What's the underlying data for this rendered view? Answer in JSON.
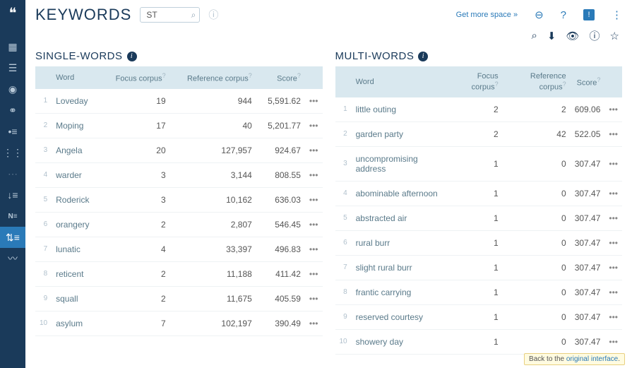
{
  "header": {
    "title": "KEYWORDS",
    "search_value": "ST",
    "get_more_space": "Get more space »"
  },
  "sidebar": {
    "items": [
      "grid",
      "list",
      "target",
      "rings",
      "indent",
      "levels",
      "dim",
      "downrank",
      "ne",
      "kw",
      "trend"
    ]
  },
  "panels": {
    "single": {
      "title": "SINGLE-WORDS",
      "cols": {
        "word": "Word",
        "focus": "Focus corpus",
        "ref": "Reference corpus",
        "score": "Score"
      }
    },
    "multi": {
      "title": "MULTI-WORDS",
      "cols": {
        "word": "Word",
        "focus": "Focus corpus",
        "ref": "Reference corpus",
        "score": "Score"
      }
    }
  },
  "chart_data": [
    {
      "type": "table",
      "title": "SINGLE-WORDS",
      "columns": [
        "Word",
        "Focus corpus",
        "Reference corpus",
        "Score"
      ],
      "rows": [
        {
          "idx": 1,
          "word": "Loveday",
          "focus": "19",
          "ref": "944",
          "score": "5,591.62"
        },
        {
          "idx": 2,
          "word": "Moping",
          "focus": "17",
          "ref": "40",
          "score": "5,201.77"
        },
        {
          "idx": 3,
          "word": "Angela",
          "focus": "20",
          "ref": "127,957",
          "score": "924.67"
        },
        {
          "idx": 4,
          "word": "warder",
          "focus": "3",
          "ref": "3,144",
          "score": "808.55"
        },
        {
          "idx": 5,
          "word": "Roderick",
          "focus": "3",
          "ref": "10,162",
          "score": "636.03"
        },
        {
          "idx": 6,
          "word": "orangery",
          "focus": "2",
          "ref": "2,807",
          "score": "546.45"
        },
        {
          "idx": 7,
          "word": "lunatic",
          "focus": "4",
          "ref": "33,397",
          "score": "496.83"
        },
        {
          "idx": 8,
          "word": "reticent",
          "focus": "2",
          "ref": "11,188",
          "score": "411.42"
        },
        {
          "idx": 9,
          "word": "squall",
          "focus": "2",
          "ref": "11,675",
          "score": "405.59"
        },
        {
          "idx": 10,
          "word": "asylum",
          "focus": "7",
          "ref": "102,197",
          "score": "390.49"
        }
      ]
    },
    {
      "type": "table",
      "title": "MULTI-WORDS",
      "columns": [
        "Word",
        "Focus corpus",
        "Reference corpus",
        "Score"
      ],
      "rows": [
        {
          "idx": 1,
          "word": "little outing",
          "focus": "2",
          "ref": "2",
          "score": "609.06"
        },
        {
          "idx": 2,
          "word": "garden party",
          "focus": "2",
          "ref": "42",
          "score": "522.05"
        },
        {
          "idx": 3,
          "word": "uncompromising address",
          "focus": "1",
          "ref": "0",
          "score": "307.47"
        },
        {
          "idx": 4,
          "word": "abominable afternoon",
          "focus": "1",
          "ref": "0",
          "score": "307.47"
        },
        {
          "idx": 5,
          "word": "abstracted air",
          "focus": "1",
          "ref": "0",
          "score": "307.47"
        },
        {
          "idx": 6,
          "word": "rural burr",
          "focus": "1",
          "ref": "0",
          "score": "307.47"
        },
        {
          "idx": 7,
          "word": "slight rural burr",
          "focus": "1",
          "ref": "0",
          "score": "307.47"
        },
        {
          "idx": 8,
          "word": "frantic carrying",
          "focus": "1",
          "ref": "0",
          "score": "307.47"
        },
        {
          "idx": 9,
          "word": "reserved courtesy",
          "focus": "1",
          "ref": "0",
          "score": "307.47"
        },
        {
          "idx": 10,
          "word": "showery day",
          "focus": "1",
          "ref": "0",
          "score": "307.47"
        }
      ]
    }
  ],
  "footer": {
    "prefix": "Back to the ",
    "link": "original interface"
  }
}
